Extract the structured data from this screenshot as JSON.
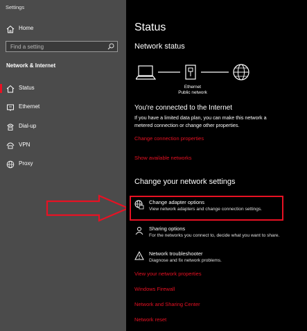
{
  "window": {
    "title": "Settings"
  },
  "sidebar": {
    "home_label": "Home",
    "search_placeholder": "Find a setting",
    "section_title": "Network & Internet",
    "items": [
      {
        "label": "Status",
        "icon": "home-status-icon",
        "active": true
      },
      {
        "label": "Ethernet",
        "icon": "ethernet-icon"
      },
      {
        "label": "Dial-up",
        "icon": "dialup-icon"
      },
      {
        "label": "VPN",
        "icon": "vpn-icon"
      },
      {
        "label": "Proxy",
        "icon": "globe-icon"
      }
    ]
  },
  "main": {
    "title": "Status",
    "network_status_heading": "Network status",
    "diagram": {
      "ethernet_label": "Ethernet",
      "network_label": "Public network"
    },
    "connected_heading": "You're connected to the Internet",
    "connected_desc_line1": "If you have a limited data plan, you can make this network a",
    "connected_desc_line2": "metered connection or change other properties.",
    "links": {
      "change_connection": "Change connection properties",
      "show_networks": "Show available networks"
    },
    "change_heading": "Change your network settings",
    "options": [
      {
        "title": "Change adapter options",
        "desc": "View network adapters and change connection settings."
      },
      {
        "title": "Sharing options",
        "desc": "For the networks you connect to, decide what you want to share."
      },
      {
        "title": "Network troubleshooter",
        "desc": "Diagnose and fix network problems."
      }
    ],
    "bottom_links": [
      "View your network properties",
      "Windows Firewall",
      "Network and Sharing Center",
      "Network reset"
    ]
  },
  "colors": {
    "accent": "#e81123",
    "sidebar_bg": "#4b4b4b",
    "main_bg": "#000000"
  }
}
